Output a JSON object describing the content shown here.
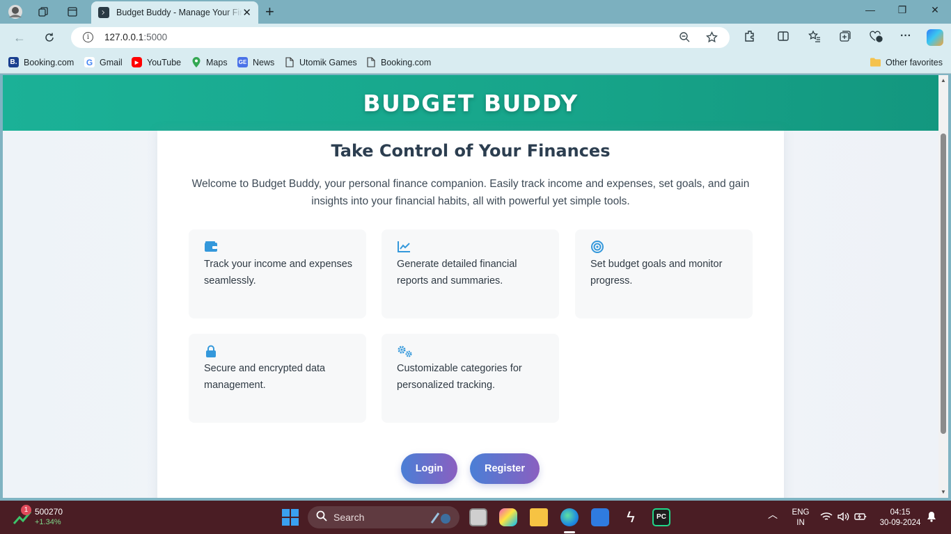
{
  "browser": {
    "tab_title": "Budget Buddy - Manage Your Finances",
    "url_host": "127.0.0.1",
    "url_port": ":5000",
    "bookmarks": [
      {
        "label": "Booking.com",
        "icon": "booking-icon"
      },
      {
        "label": "Gmail",
        "icon": "google-icon"
      },
      {
        "label": "YouTube",
        "icon": "youtube-icon"
      },
      {
        "label": "Maps",
        "icon": "maps-icon"
      },
      {
        "label": "News",
        "icon": "news-icon"
      },
      {
        "label": "Utomik Games",
        "icon": "page-icon"
      },
      {
        "label": "Booking.com",
        "icon": "page-icon"
      }
    ],
    "other_favorites": "Other favorites"
  },
  "page": {
    "brand": "BUDGET BUDDY",
    "heading": "Take Control of Your Finances",
    "intro": "Welcome to Budget Buddy, your personal finance companion. Easily track income and expenses, set goals, and gain insights into your financial habits, all with powerful yet simple tools.",
    "features": [
      {
        "icon": "wallet-icon",
        "text": "Track your income and expenses seamlessly."
      },
      {
        "icon": "chart-line-icon",
        "text": "Generate detailed financial reports and summaries."
      },
      {
        "icon": "target-icon",
        "text": "Set budget goals and monitor progress."
      },
      {
        "icon": "lock-icon",
        "text": "Secure and encrypted data management."
      },
      {
        "icon": "gears-icon",
        "text": "Customizable categories for personalized tracking."
      }
    ],
    "login_label": "Login",
    "register_label": "Register",
    "accent_color": "#1bb197",
    "icon_color": "#3498db"
  },
  "taskbar": {
    "stock_badge": "1",
    "stock_value": "500270",
    "stock_change": "+1.34%",
    "search_label": "Search",
    "lang_top": "ENG",
    "lang_bottom": "IN",
    "time": "04:15",
    "date": "30-09-2024"
  }
}
